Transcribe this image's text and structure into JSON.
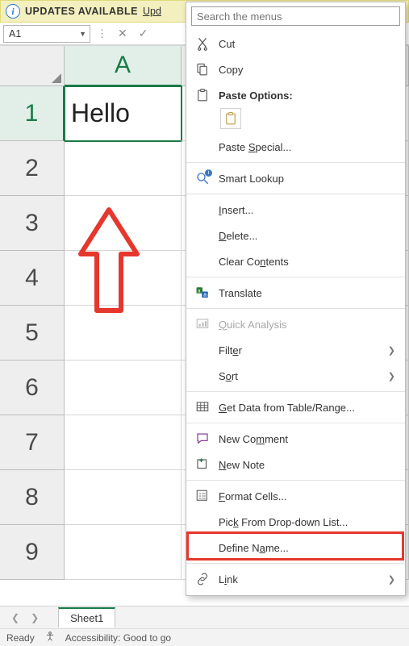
{
  "banner": {
    "text": "UPDATES AVAILABLE",
    "link": "Upd"
  },
  "namebox": "A1",
  "grid": {
    "col_label": "A",
    "rows": [
      "1",
      "2",
      "3",
      "4",
      "5",
      "6",
      "7",
      "8",
      "9"
    ],
    "a1": "Hello"
  },
  "menu": {
    "search_placeholder": "Search the menus",
    "cut": "Cut",
    "copy": "Copy",
    "paste_options": "Paste Options:",
    "paste_special": "Paste Special...",
    "smart_lookup": "Smart Lookup",
    "insert": "Insert...",
    "delete": "Delete...",
    "clear_contents": "Clear Contents",
    "translate": "Translate",
    "quick_analysis": "Quick Analysis",
    "filter": "Filter",
    "sort": "Sort",
    "get_data": "Get Data from Table/Range...",
    "new_comment": "New Comment",
    "new_note": "New Note",
    "format_cells": "Format Cells...",
    "pick_list": "Pick From Drop-down List...",
    "define_name": "Define Name...",
    "link": "Link"
  },
  "tabs": {
    "sheet1": "Sheet1"
  },
  "status": {
    "ready": "Ready",
    "accessibility": "Accessibility: Good to go"
  }
}
